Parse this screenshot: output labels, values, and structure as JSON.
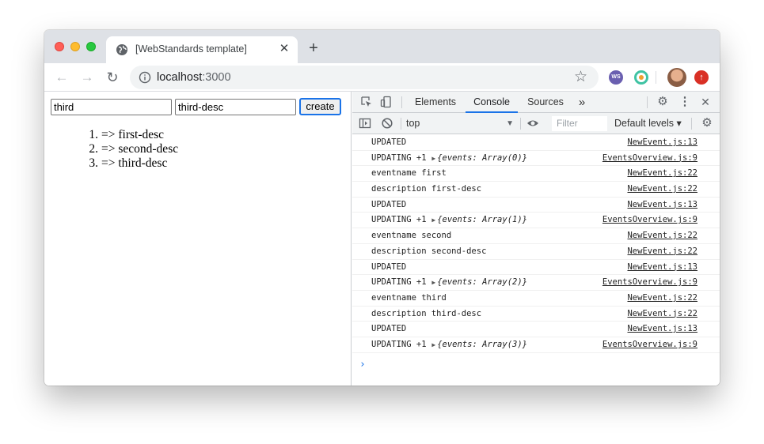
{
  "window": {
    "tab_title": "[WebStandards template]",
    "close_glyph": "✕",
    "new_tab_glyph": "+"
  },
  "toolbar": {
    "back_glyph": "←",
    "forward_glyph": "→",
    "reload_glyph": "↻",
    "url_host": "localhost",
    "url_port": ":3000",
    "star_glyph": "☆",
    "ext_label": "WS",
    "upload_glyph": "↑"
  },
  "page": {
    "name_input": "third",
    "desc_input": "third-desc",
    "create_label": "create",
    "events": [
      {
        "num": "1.",
        "text": "=> first-desc"
      },
      {
        "num": "2.",
        "text": "=> second-desc"
      },
      {
        "num": "3.",
        "text": "=> third-desc"
      }
    ]
  },
  "devtools": {
    "tabs": [
      "Elements",
      "Console",
      "Sources"
    ],
    "active_tab": "Console",
    "more_glyph": "»",
    "context": "top",
    "filter_placeholder": "Filter",
    "levels": "Default levels ▾",
    "console_rows": [
      {
        "msg": "UPDATED",
        "src": "NewEvent.js:13"
      },
      {
        "msg": "UPDATING +1",
        "obj": "{events: Array(0)}",
        "src": "EventsOverview.js:9"
      },
      {
        "msg": "eventname first",
        "src": "NewEvent.js:22"
      },
      {
        "msg": "description first-desc",
        "src": "NewEvent.js:22"
      },
      {
        "msg": "UPDATED",
        "src": "NewEvent.js:13"
      },
      {
        "msg": "UPDATING +1",
        "obj": "{events: Array(1)}",
        "src": "EventsOverview.js:9"
      },
      {
        "msg": "eventname second",
        "src": "NewEvent.js:22"
      },
      {
        "msg": "description second-desc",
        "src": "NewEvent.js:22"
      },
      {
        "msg": "UPDATED",
        "src": "NewEvent.js:13"
      },
      {
        "msg": "UPDATING +1",
        "obj": "{events: Array(2)}",
        "src": "EventsOverview.js:9"
      },
      {
        "msg": "eventname third",
        "src": "NewEvent.js:22"
      },
      {
        "msg": "description third-desc",
        "src": "NewEvent.js:22"
      },
      {
        "msg": "UPDATED",
        "src": "NewEvent.js:13"
      },
      {
        "msg": "UPDATING +1",
        "obj": "{events: Array(3)}",
        "src": "EventsOverview.js:9"
      }
    ],
    "prompt_glyph": "›"
  }
}
